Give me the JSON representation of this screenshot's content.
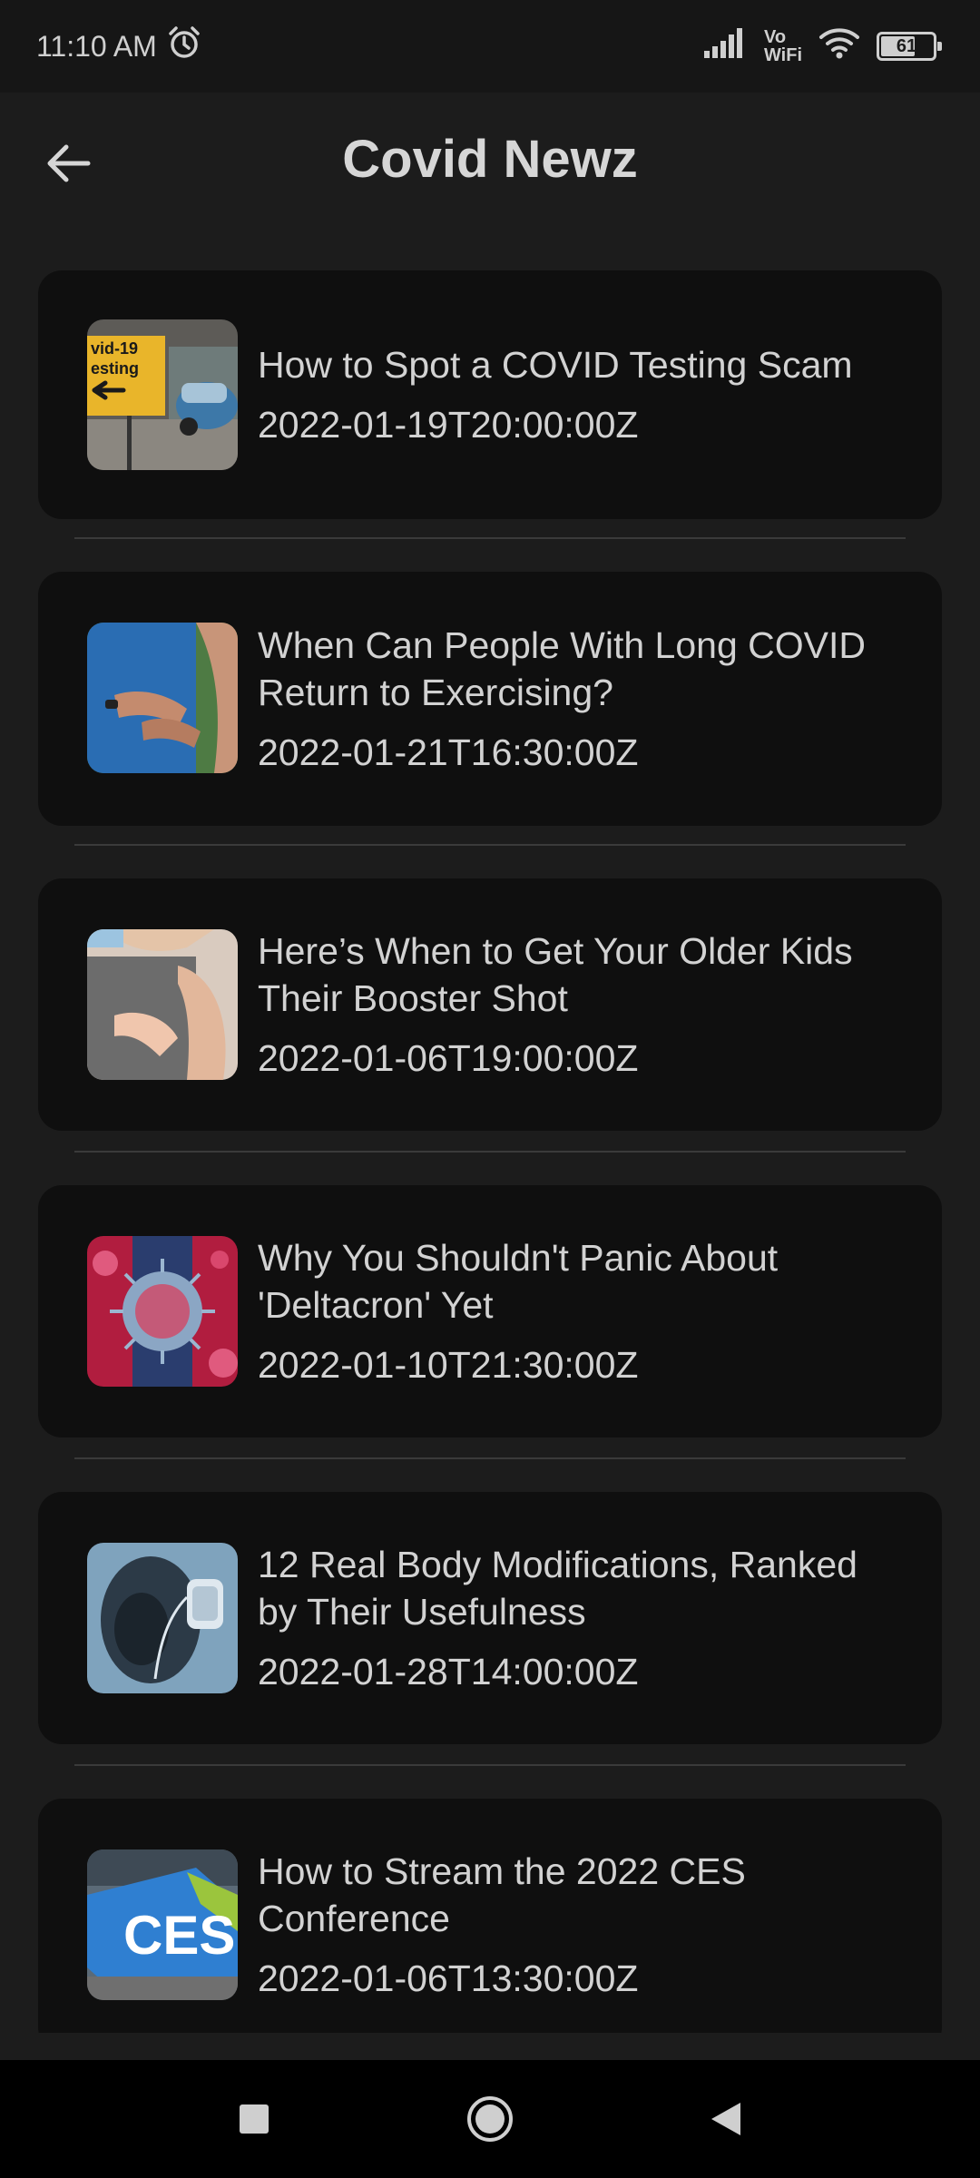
{
  "status_bar": {
    "time": "11:10 AM",
    "vo": "Vo",
    "wifi": "WiFi",
    "battery": "61"
  },
  "app_bar": {
    "title": "Covid Newz"
  },
  "articles": [
    {
      "title": "How to Spot a COVID Testing Scam",
      "date": "2022-01-19T20:00:00Z"
    },
    {
      "title": "When Can People With Long COVID Return to Exercising?",
      "date": "2022-01-21T16:30:00Z"
    },
    {
      "title": "Here’s When to Get Your Older Kids Their Booster Shot",
      "date": "2022-01-06T19:00:00Z"
    },
    {
      "title": "Why You Shouldn't Panic About 'Deltacron' Yet",
      "date": "2022-01-10T21:30:00Z"
    },
    {
      "title": "12 Real Body Modifications, Ranked by Their Usefulness",
      "date": "2022-01-28T14:00:00Z"
    },
    {
      "title": "How to Stream the 2022 CES Conference",
      "date": "2022-01-06T13:30:00Z"
    }
  ],
  "thumbnails": {
    "sign_text_1": "vid-19",
    "sign_text_2": "esting",
    "ces_logo": "CES"
  },
  "colors": {
    "background": "#1c1c1c",
    "card": "#0f0f0f",
    "text": "#d2d2d2"
  }
}
